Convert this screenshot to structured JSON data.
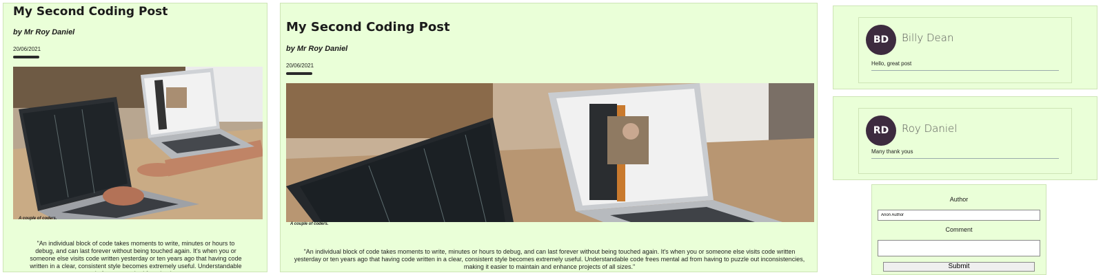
{
  "post": {
    "title": "My Second Coding Post",
    "author": "by Mr Roy Daniel",
    "date": "20/06/2021",
    "caption": "A couple of coders.",
    "body_narrow": "\"An individual block of code takes moments to write, minutes or hours to debug, and can last forever without being touched again. It's when you or someone else visits code written yesterday or ten years ago that having code written in a clear, consistent style becomes extremely useful. Understandable code frees mental ad from having to",
    "body_wide": "\"An individual block of code takes moments to write, minutes or hours to debug, and can last forever without being touched again. It's when you or someone else visits code written yesterday or ten years ago that having code written in a clear, consistent style becomes extremely useful. Understandable code frees mental ad from having to puzzle out inconsistencies, making it easier to maintain and enhance projects of all sizes.\""
  },
  "comments": [
    {
      "initials": "BD",
      "name": "Billy Dean",
      "text": "Hello, great post"
    },
    {
      "initials": "RD",
      "name": "Roy Daniel",
      "text": "Many thank yous"
    }
  ],
  "form": {
    "author_label": "Author",
    "author_value": "Anon Author",
    "comment_label": "Comment",
    "comment_value": "",
    "submit_label": "Submit"
  },
  "colors": {
    "panel_bg": "#eaffd8",
    "avatar_bg": "#3d2b3f"
  }
}
